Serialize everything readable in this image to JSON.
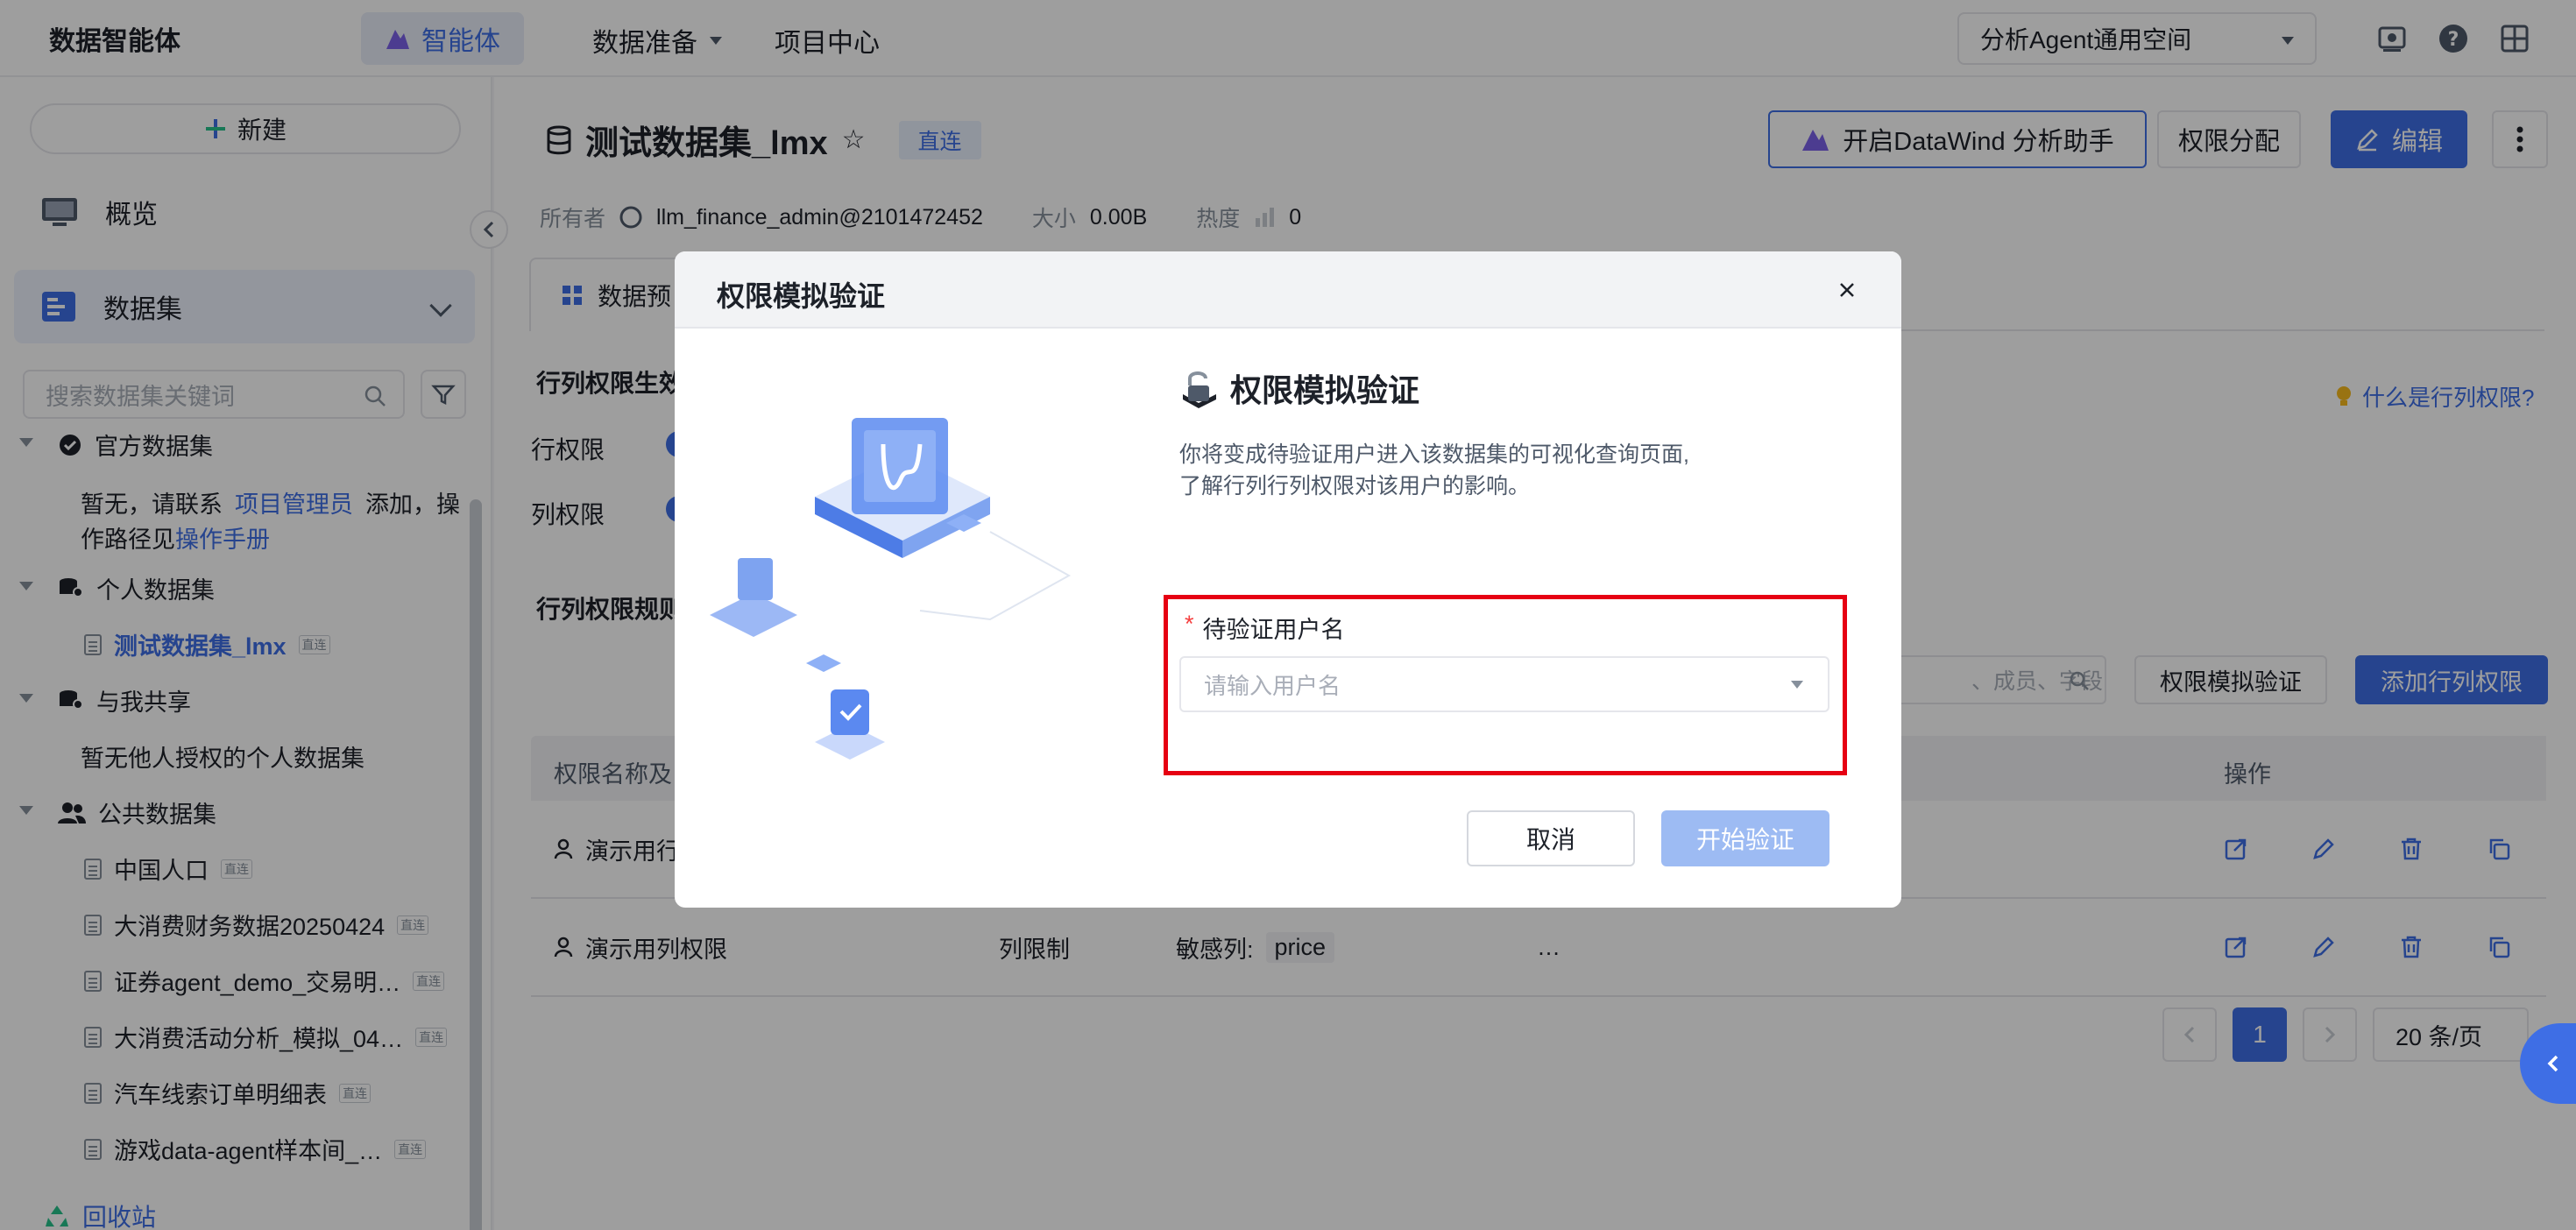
{
  "topbar": {
    "brand": "数据智能体",
    "nav_active": "智能体",
    "nav_data_prep": "数据准备",
    "nav_project": "项目中心",
    "space": "分析Agent通用空间"
  },
  "sidebar": {
    "new_label": "新建",
    "overview": "概览",
    "dataset": "数据集",
    "search_placeholder": "搜索数据集关键词",
    "official_group": "官方数据集",
    "official_empty_1": "暂无，请联系",
    "official_link_pm": "项目管理员",
    "official_empty_2": "添加，操",
    "official_empty_3": "作路径见",
    "official_link_manual": "操作手册",
    "personal_group": "个人数据集",
    "personal_items": [
      {
        "name": "测试数据集_lmx",
        "tag": "直连"
      }
    ],
    "shared_group": "与我共享",
    "shared_empty": "暂无他人授权的个人数据集",
    "public_group": "公共数据集",
    "public_items": [
      {
        "name": "中国人口",
        "tag": "直连"
      },
      {
        "name": "大消费财务数据20250424",
        "tag": "直连"
      },
      {
        "name": "证券agent_demo_交易明…",
        "tag": "直连"
      },
      {
        "name": "大消费活动分析_模拟_04…",
        "tag": "直连"
      },
      {
        "name": "汽车线索订单明细表",
        "tag": "直连"
      },
      {
        "name": "游戏data-agent样本间_…",
        "tag": "直连"
      }
    ],
    "recycle": "回收站"
  },
  "main": {
    "title": "测试数据集_lmx",
    "badge": "直连",
    "btn_assistant": "开启DataWind 分析助手",
    "btn_permission": "权限分配",
    "btn_edit": "编辑",
    "owner_label": "所有者",
    "owner_value": "llm_finance_admin@2101472452",
    "size_label": "大小",
    "size_value": "0.00B",
    "heat_label": "热度",
    "heat_value": "0",
    "tab_preview": "数据预",
    "section_effect": "行列权限生效",
    "row_perm": "行权限",
    "col_perm": "列权限",
    "help_link": "什么是行列权限?",
    "rules_title": "行列权限规则",
    "rule_search_placeholder": "、成员、字段",
    "btn_sim": "权限模拟验证",
    "btn_add_rule": "添加行列权限",
    "table": {
      "col_name": "权限名称及",
      "col_ops": "操作",
      "rows": [
        {
          "name": "演示用行",
          "type": "",
          "detail_label": "",
          "detail_value": ""
        },
        {
          "name": "演示用列权限",
          "type": "列限制",
          "detail_label": "敏感列:",
          "detail_value": "price",
          "more": "…"
        }
      ]
    },
    "pagination": {
      "current": "1",
      "page_size": "20 条/页"
    }
  },
  "modal": {
    "title": "权限模拟验证",
    "heading": "权限模拟验证",
    "desc_line1": "你将变成待验证用户进入该数据集的可视化查询页面,",
    "desc_line2": "了解行列行列权限对该用户的影响。",
    "field_required": "*",
    "field_label": "待验证用户名",
    "field_placeholder": "请输入用户名",
    "btn_cancel": "取消",
    "btn_start": "开始验证"
  },
  "colors": {
    "primary": "#3e6ee5",
    "highlight": "#e60012",
    "disabled_primary": "#9dbbf3"
  }
}
